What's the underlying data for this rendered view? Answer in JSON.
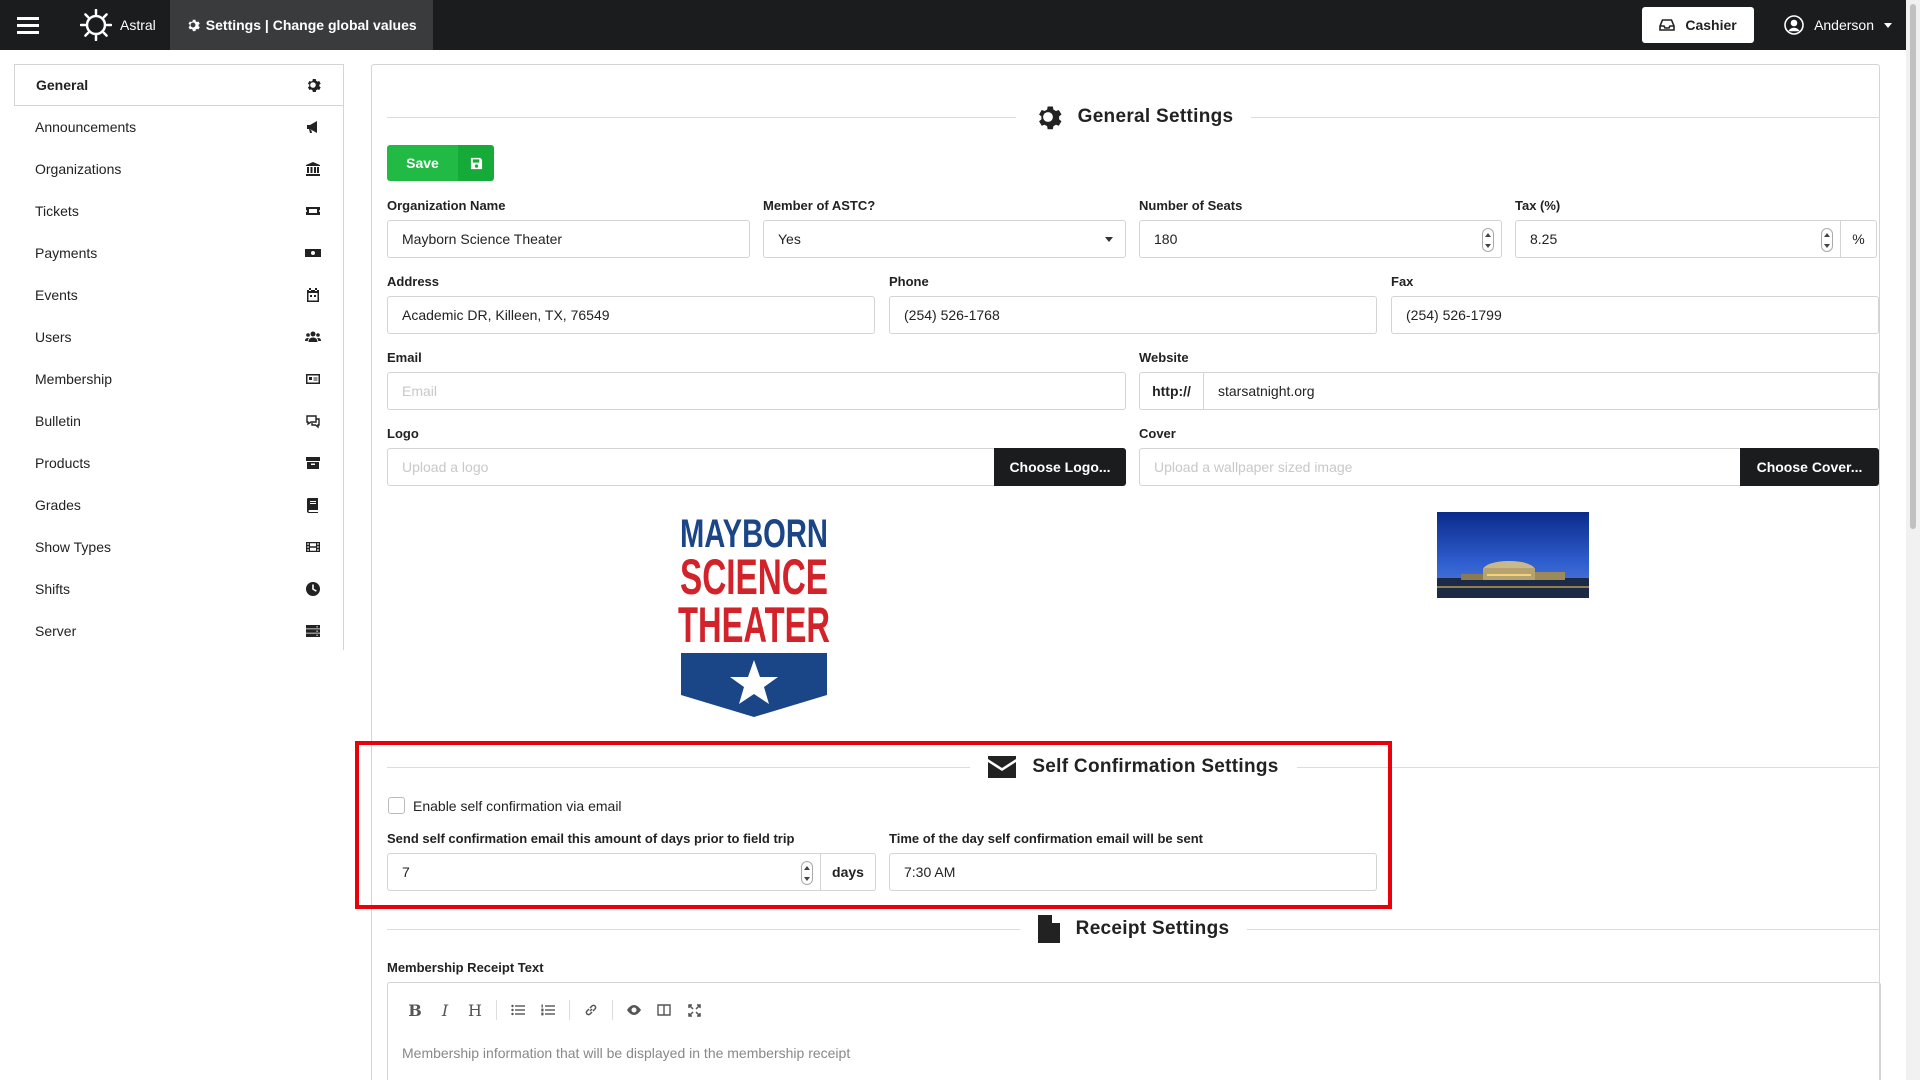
{
  "topbar": {
    "app_name": "Astral",
    "breadcrumb": "Settings | Change global values",
    "cashier_label": "Cashier",
    "user_name": "Anderson"
  },
  "sidebar": {
    "items": [
      {
        "label": "General",
        "icon": "gear-icon",
        "active": true
      },
      {
        "label": "Announcements",
        "icon": "megaphone-icon"
      },
      {
        "label": "Organizations",
        "icon": "institution-icon"
      },
      {
        "label": "Tickets",
        "icon": "ticket-icon"
      },
      {
        "label": "Payments",
        "icon": "money-icon"
      },
      {
        "label": "Events",
        "icon": "calendar-icon"
      },
      {
        "label": "Users",
        "icon": "users-icon"
      },
      {
        "label": "Membership",
        "icon": "id-card-icon"
      },
      {
        "label": "Bulletin",
        "icon": "comments-icon"
      },
      {
        "label": "Products",
        "icon": "box-icon"
      },
      {
        "label": "Grades",
        "icon": "book-icon"
      },
      {
        "label": "Show Types",
        "icon": "film-icon"
      },
      {
        "label": "Shifts",
        "icon": "clock-icon"
      },
      {
        "label": "Server",
        "icon": "server-icon"
      }
    ]
  },
  "general": {
    "title": "General Settings",
    "save_label": "Save",
    "org_name_label": "Organization Name",
    "org_name_value": "Mayborn Science Theater",
    "astc_label": "Member of ASTC?",
    "astc_value": "Yes",
    "seats_label": "Number of Seats",
    "seats_value": "180",
    "tax_label": "Tax (%)",
    "tax_value": "8.25",
    "tax_suffix": "%",
    "address_label": "Address",
    "address_value": "Academic DR, Killeen, TX, 76549",
    "phone_label": "Phone",
    "phone_value": "(254) 526-1768",
    "fax_label": "Fax",
    "fax_value": "(254) 526-1799",
    "email_label": "Email",
    "email_placeholder": "Email",
    "website_label": "Website",
    "website_prefix": "http://",
    "website_value": "starsatnight.org",
    "logo_label": "Logo",
    "logo_placeholder": "Upload a logo",
    "logo_button": "Choose Logo...",
    "cover_label": "Cover",
    "cover_placeholder": "Upload a wallpaper sized image",
    "cover_button": "Choose Cover...",
    "logo_text": [
      "MAYBORN",
      "SCIENCE",
      "THEATER"
    ]
  },
  "self_confirmation": {
    "title": "Self Confirmation Settings",
    "enable_label": "Enable self confirmation via email",
    "enabled": false,
    "days_label": "Send self confirmation email this amount of days prior to field trip",
    "days_value": "7",
    "days_suffix": "days",
    "time_label": "Time of the day self confirmation email will be sent",
    "time_value": "7:30 AM"
  },
  "receipt": {
    "title": "Receipt Settings",
    "membership_label": "Membership Receipt Text",
    "membership_placeholder": "Membership information that will be displayed in the membership receipt",
    "toolbar": [
      "B",
      "I",
      "H"
    ]
  },
  "colors": {
    "navbar": "#1b1c1d",
    "save_green": "#21ba45",
    "highlight_red": "#e8000b",
    "logo_blue": "#1a4587",
    "logo_red": "#d2232a"
  }
}
